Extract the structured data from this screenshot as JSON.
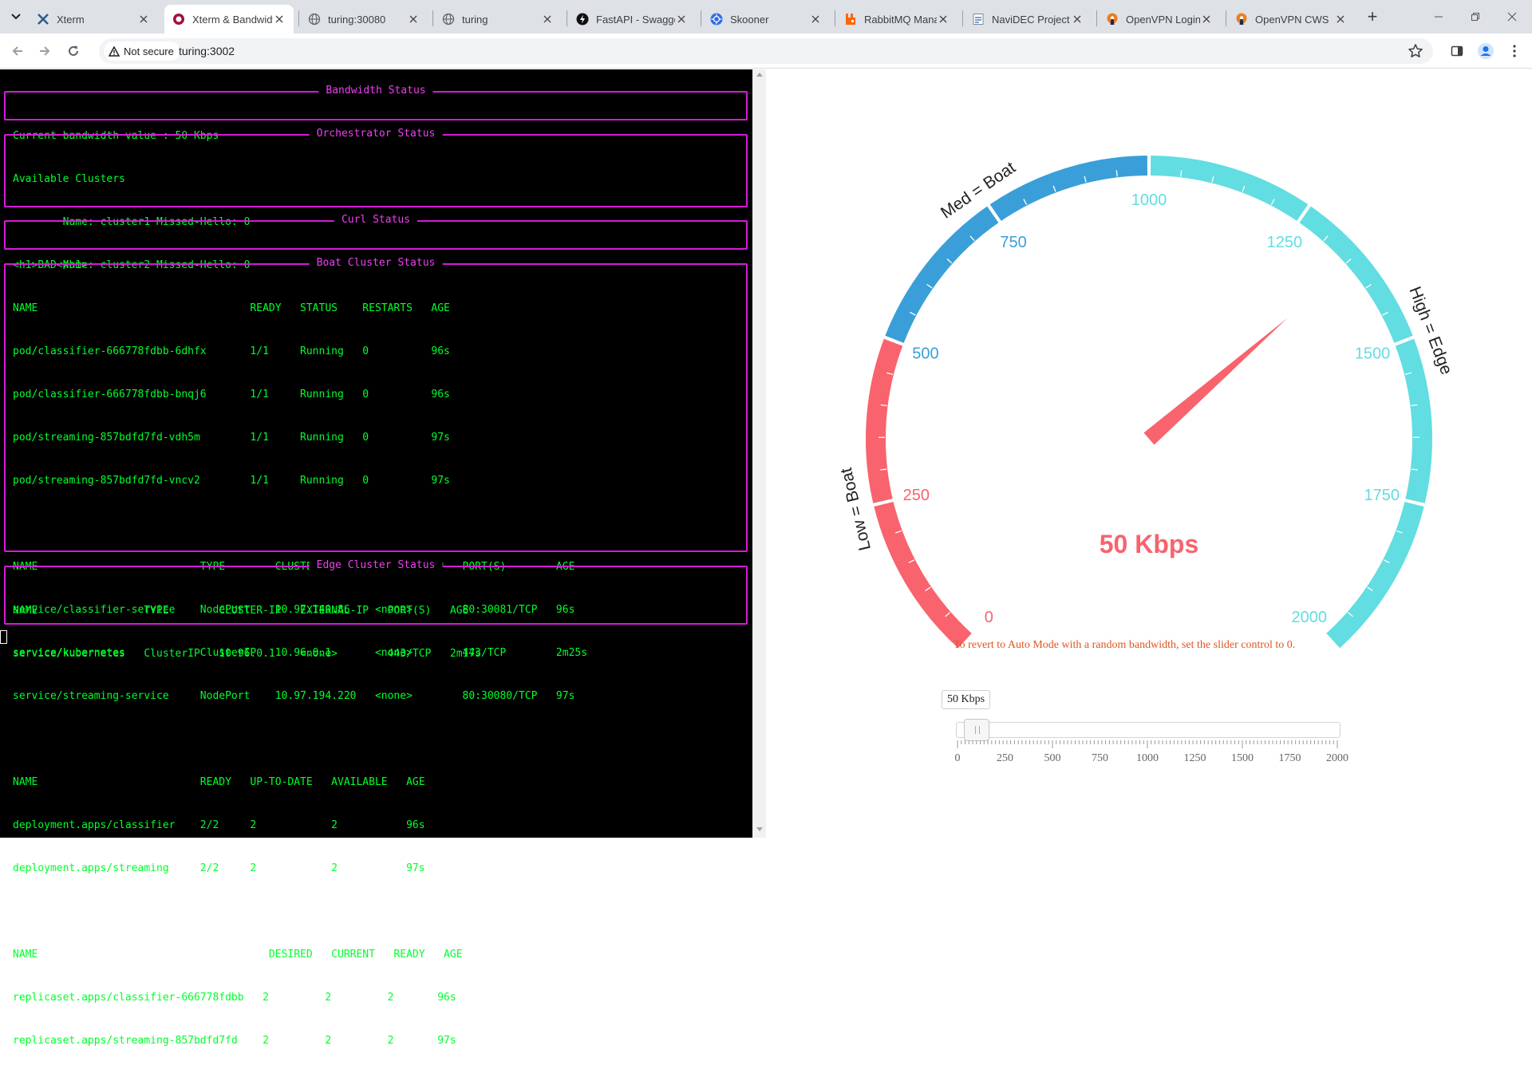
{
  "browser": {
    "tabs": [
      {
        "title": "Xterm",
        "icon": "xterm-icon",
        "active": false
      },
      {
        "title": "Xterm & Bandwidth",
        "icon": "app-dot-icon",
        "active": true
      },
      {
        "title": "turing:30080",
        "icon": "globe-icon",
        "active": false
      },
      {
        "title": "turing",
        "icon": "globe-icon",
        "active": false
      },
      {
        "title": "FastAPI - Swagger UI",
        "icon": "fastapi-icon",
        "active": false
      },
      {
        "title": "Skooner",
        "icon": "kubernetes-icon",
        "active": false
      },
      {
        "title": "RabbitMQ Management",
        "icon": "rabbitmq-icon",
        "active": false
      },
      {
        "title": "NaviDEC Project - ",
        "icon": "document-icon",
        "active": false
      },
      {
        "title": "OpenVPN Login",
        "icon": "openvpn-icon",
        "active": false
      },
      {
        "title": "OpenVPN CWS",
        "icon": "openvpn-icon",
        "active": false
      }
    ],
    "security_label": "Not secure",
    "url": "turing:3002"
  },
  "terminal": {
    "panels": [
      {
        "title": "Bandwidth Status",
        "lines": [
          "Current bandwidth value : 50 Kbps"
        ]
      },
      {
        "title": "Orchestrator Status",
        "lines": [
          "Available Clusters",
          "        Name: cluster1 Missed-Hello: 0",
          "        Name: cluster2 Missed-Hello: 0"
        ]
      },
      {
        "title": "Curl Status",
        "lines": [
          "<h1>BAD</h1>"
        ]
      },
      {
        "title": "Boat Cluster Status",
        "lines": [
          "NAME                                  READY   STATUS    RESTARTS   AGE",
          "pod/classifier-666778fdbb-6dhfx       1/1     Running   0          96s",
          "pod/classifier-666778fdbb-bnqj6       1/1     Running   0          96s",
          "pod/streaming-857bdfd7fd-vdh5m        1/1     Running   0          97s",
          "pod/streaming-857bdfd7fd-vncv2        1/1     Running   0          97s",
          "",
          "NAME                          TYPE        CLUSTER-IP      EXTERNAL-IP   PORT(S)        AGE",
          "service/classifier-service    NodePort    10.97.140.86    <none>        80:30081/TCP   96s",
          "service/kubernetes            ClusterIP   10.96.0.1       <none>        443/TCP        2m25s",
          "service/streaming-service     NodePort    10.97.194.220   <none>        80:30080/TCP   97s",
          "",
          "NAME                          READY   UP-TO-DATE   AVAILABLE   AGE",
          "deployment.apps/classifier    2/2     2            2           96s",
          "deployment.apps/streaming     2/2     2            2           97s",
          "",
          "NAME                                     DESIRED   CURRENT   READY   AGE",
          "replicaset.apps/classifier-666778fdbb   2         2         2       96s",
          "replicaset.apps/streaming-857bdfd7fd    2         2         2       97s"
        ]
      },
      {
        "title": "Edge Cluster Status",
        "lines": [
          "NAME                 TYPE        CLUSTER-IP   EXTERNAL-IP   PORT(S)   AGE",
          "service/kubernetes   ClusterIP   10.96.0.1    <none>        443/TCP   2m17s"
        ]
      }
    ]
  },
  "gauge": {
    "min": 0,
    "max": 2000,
    "value": 50,
    "value_display": "50 Kbps",
    "tick_labels": [
      "0",
      "250",
      "500",
      "750",
      "1000",
      "1250",
      "1500",
      "1750",
      "2000"
    ],
    "zones": [
      {
        "label": "Low = Boat",
        "from": 0,
        "to": 500,
        "color": "#f8636d"
      },
      {
        "label": "Med = Boat",
        "from": 500,
        "to": 1000,
        "color": "#3a9fd8"
      },
      {
        "label": "High = Edge",
        "from": 1000,
        "to": 2000,
        "color": "#62dde1"
      }
    ],
    "needle_color": "#f8636d",
    "value_color": "#f8636d"
  },
  "hint_text": "To revert to Auto Mode with a random bandwidth, set the slider control to 0.",
  "slider": {
    "value_label": "50 Kbps",
    "min": 0,
    "max": 2000,
    "value": 50,
    "tick_labels": [
      "0",
      "250",
      "500",
      "750",
      "1000",
      "1250",
      "1500",
      "1750",
      "2000"
    ]
  }
}
